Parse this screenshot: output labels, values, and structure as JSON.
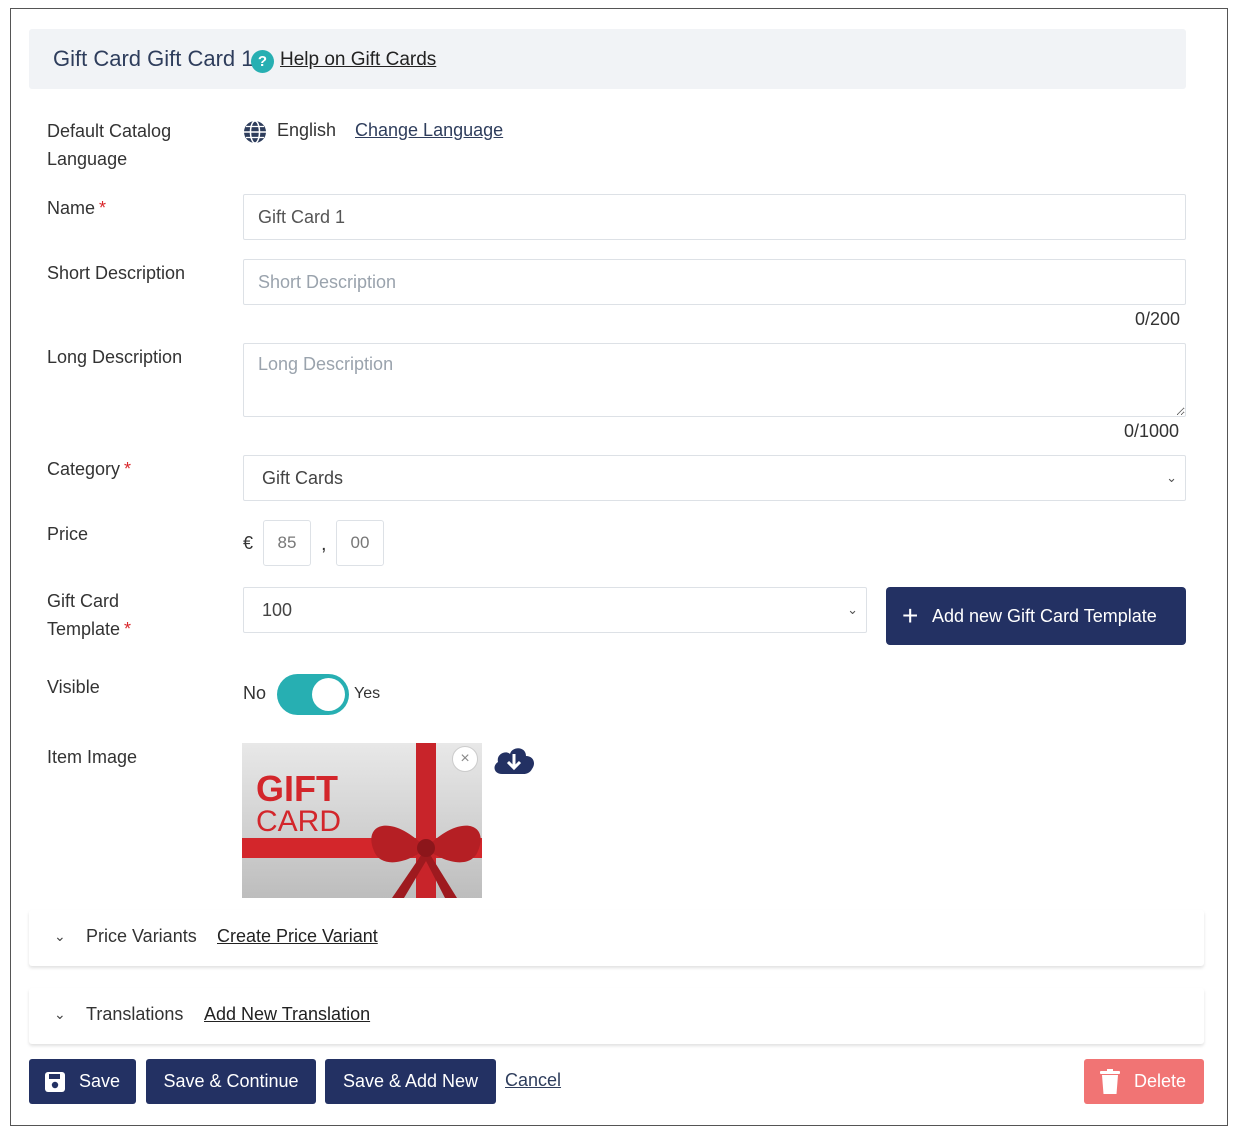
{
  "header": {
    "title": "Gift Card Gift Card 1",
    "help_icon_glyph": "?",
    "help_link": "Help on Gift Cards"
  },
  "language": {
    "label_line1": "Default Catalog",
    "label_line2": "Language",
    "current": "English",
    "change_link": "Change Language"
  },
  "name": {
    "label": "Name",
    "required_mark": "*",
    "value": "Gift Card 1"
  },
  "short_description": {
    "label": "Short Description",
    "placeholder": "Short Description",
    "counter": "0/200"
  },
  "long_description": {
    "label": "Long Description",
    "placeholder": "Long Description",
    "counter": "0/1000"
  },
  "category": {
    "label": "Category",
    "required_mark": "*",
    "selected": "Gift Cards"
  },
  "price": {
    "label": "Price",
    "currency": "€",
    "whole": "85",
    "separator": ",",
    "cents": "00"
  },
  "template": {
    "label_line1": "Gift Card",
    "label_line2": "Template",
    "required_mark": "*",
    "selected": "100",
    "add_button": "Add new Gift Card Template"
  },
  "visible": {
    "label": "Visible",
    "no": "No",
    "yes": "Yes",
    "state": true
  },
  "item_image": {
    "label": "Item Image",
    "image_text_line1": "GIFT",
    "image_text_line2": "CARD",
    "remove_glyph": "×"
  },
  "price_variants": {
    "title": "Price Variants",
    "link": "Create Price Variant"
  },
  "translations": {
    "title": "Translations",
    "link": "Add New Translation"
  },
  "actions": {
    "save": "Save",
    "save_continue": "Save & Continue",
    "save_add_new": "Save & Add New",
    "cancel": "Cancel",
    "delete": "Delete"
  },
  "colors": {
    "primary": "#233163",
    "accent": "#27afb2",
    "danger": "#f17474",
    "required": "#d9262b"
  }
}
